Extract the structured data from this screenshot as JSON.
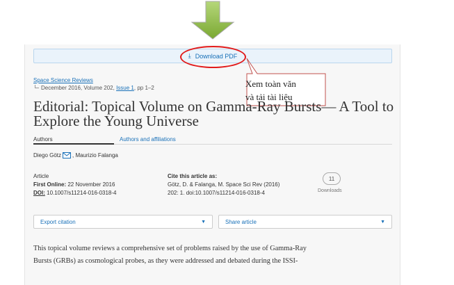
{
  "download": {
    "label": "Download PDF",
    "icon": "download-icon"
  },
  "callout": {
    "line1": "Xem toàn văn",
    "line2": "và tải tài liệu"
  },
  "journal": {
    "name": "Space Science Reviews"
  },
  "issue": {
    "prefix": "December 2016, Volume 202, ",
    "issue_link": "Issue 1",
    "pages": ", pp 1–2"
  },
  "article": {
    "title": "Editorial: Topical Volume on Gamma-Ray Bursts— A Tool to Explore the Young Universe"
  },
  "tabs": {
    "authors": "Authors",
    "affiliations": "Authors and affiliations"
  },
  "authors": {
    "first": "Diego Götz",
    "rest": ", Maurizio Falanga"
  },
  "meta": {
    "type": "Article",
    "first_online_label": "First Online:",
    "first_online_value": " 22 November 2016",
    "doi_label": "DOI:",
    "doi_value": " 10.1007/s11214-016-0318-4"
  },
  "cite": {
    "heading": "Cite this article as:",
    "line1": "Götz, D. & Falanga, M. Space Sci Rev (2016)",
    "line2": "202: 1. doi:10.1007/s11214-016-0318-4"
  },
  "metrics": {
    "downloads_count": "11",
    "downloads_label": "Downloads"
  },
  "actions": {
    "export_label": "Export citation",
    "share_label": "Share article"
  },
  "abstract": {
    "line1": "This topical volume reviews a comprehensive set of problems raised by the use of Gamma-Ray",
    "line2": "Bursts (GRBs) as cosmological probes, as they were addressed and debated during the ISSI-"
  },
  "colors": {
    "link": "#1870b8",
    "highlight": "#e21a1a",
    "arrow": "#8fbb3c"
  }
}
